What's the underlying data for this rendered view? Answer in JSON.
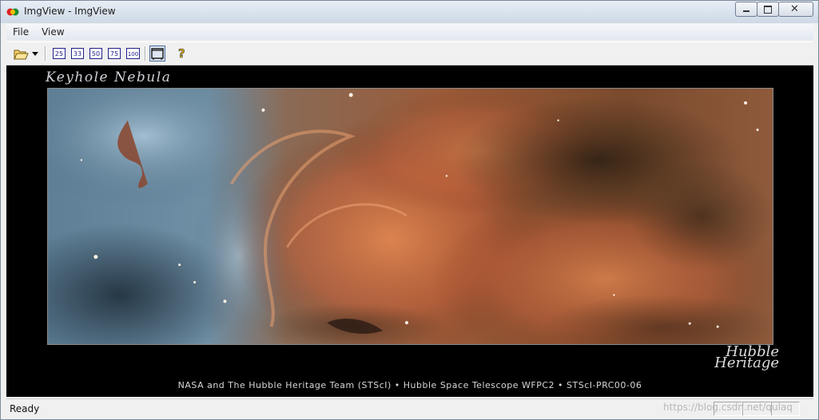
{
  "window": {
    "title": "ImgView - ImgView"
  },
  "menu": {
    "items": [
      "File",
      "View"
    ]
  },
  "toolbar": {
    "zoom_buttons": [
      "25",
      "33",
      "50",
      "75",
      "100"
    ],
    "icons": [
      "open-folder-icon",
      "dropdown-arrow-icon",
      "fit-window-icon",
      "help-icon"
    ]
  },
  "image": {
    "title": "Keyhole Nebula",
    "logo_line1": "Hubble",
    "logo_line2": "Heritage",
    "credit": "NASA and The Hubble Heritage Team (STScI) •  Hubble Space Telescope WFPC2 • STScI-PRC00-06"
  },
  "status": {
    "text": "Ready",
    "watermark": "https://blog.csdn.net/qulaq"
  },
  "colors": {
    "canvas_bg": "#000000",
    "nebula_orange": "#c2643a",
    "nebula_blue": "#6f8fa8"
  }
}
